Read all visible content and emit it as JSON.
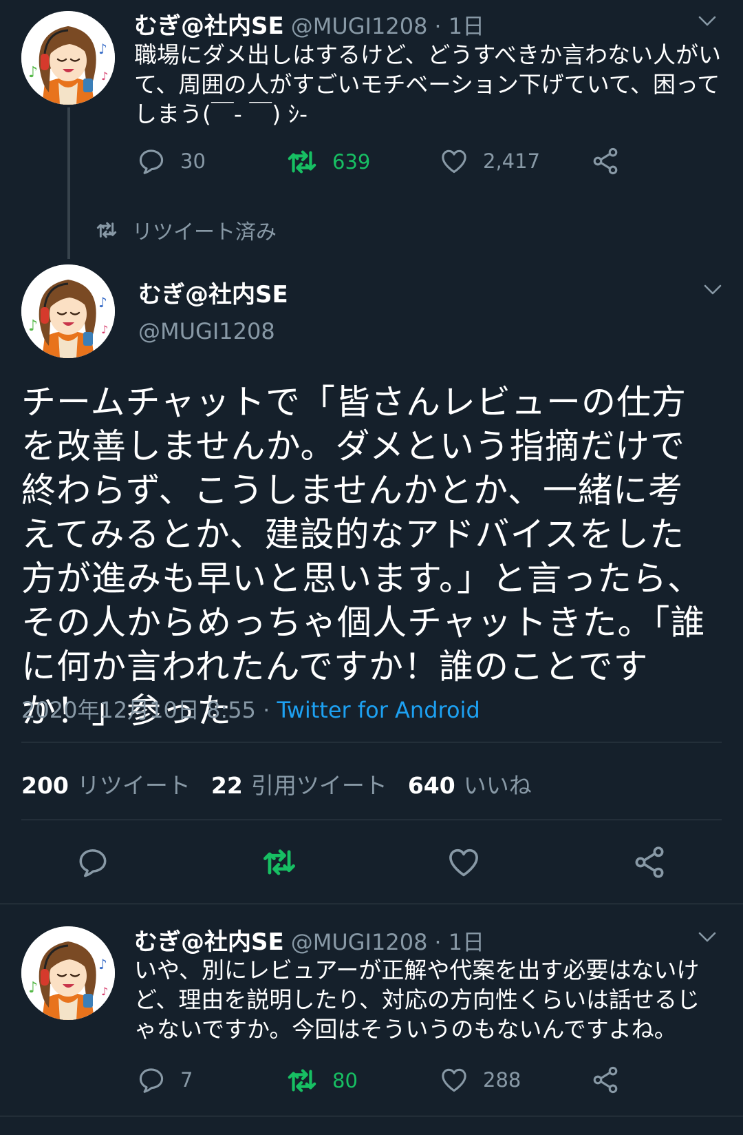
{
  "tweet1": {
    "name": "むぎ@社内SE",
    "handle": "@MUGI1208",
    "time": "· 1日",
    "text": "職場にダメ出しはするけど、どうすべきか言わない人がいて、周囲の人がすごいモチベーション下げていて、困ってしまう(￣- ￣) ｼ-",
    "replies": "30",
    "retweets": "639",
    "likes": "2,417"
  },
  "retweet_status": "リツイート済み",
  "main": {
    "name": "むぎ@社内SE",
    "handle": "@MUGI1208",
    "text": "チームチャットで「皆さんレビューの仕方を改善しませんか。ダメという指摘だけで終わらず、こうしませんかとか、一緒に考えてみるとか、建設的なアドバイスをした方が進みも早いと思います。」と言ったら、その人からめっちゃ個人チャットきた。「誰に何か言われたんですか！誰のことですか！」参った",
    "datetime": "2020年12月10日 8:55",
    "separator": " · ",
    "client": "Twitter for Android",
    "retweet_count": "200",
    "retweet_label": "リツイート",
    "quote_count": "22",
    "quote_label": "引用ツイート",
    "like_count": "640",
    "like_label": "いいね"
  },
  "tweet3": {
    "name": "むぎ@社内SE",
    "handle": "@MUGI1208",
    "time": "· 1日",
    "text": "いや、別にレビュアーが正解や代案を出す必要はないけど、理由を説明したり、対応の方向性くらいは話せるじゃないですか。今回はそういうのもないんですよね。",
    "replies": "7",
    "retweets": "80",
    "likes": "288"
  },
  "colors": {
    "background": "#15202b",
    "secondary_text": "#8899a6",
    "retweet_green": "#17bf63",
    "link_blue": "#1da1f2",
    "divider": "#38444d"
  },
  "icons": [
    "reply-icon",
    "retweet-icon",
    "like-icon",
    "share-icon",
    "chevron-down-icon",
    "retweeted-icon"
  ]
}
